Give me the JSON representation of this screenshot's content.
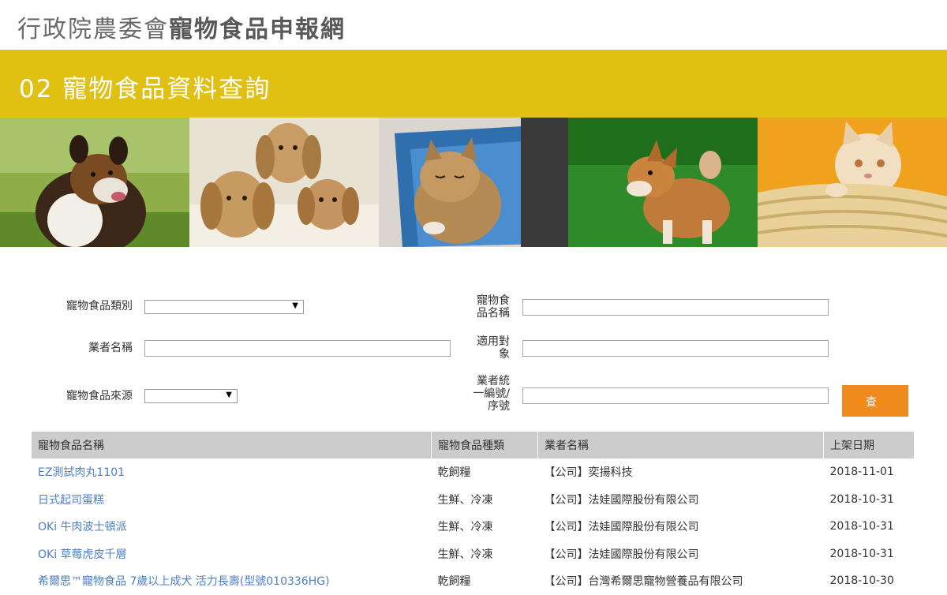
{
  "header": {
    "title_light": "行政院農委會",
    "title_bold": "寵物食品申報網"
  },
  "section": {
    "title": "02 寵物食品資料查詢"
  },
  "photos": [
    {
      "subject": "collie-dog"
    },
    {
      "subject": "dachshund-puppies"
    },
    {
      "subject": "tabby-kitten"
    },
    {
      "subject": "shiba-puppy"
    },
    {
      "subject": "cat-in-basket"
    }
  ],
  "form": {
    "category_label": "寵物食品類別",
    "category_value": "",
    "product_name_label": "寵物食品名稱",
    "product_name_value": "",
    "vendor_label": "業者名稱",
    "vendor_value": "",
    "target_label": "適用對象",
    "target_value": "",
    "source_label": "寵物食品來源",
    "source_value": "",
    "tax_id_label": "業者統一編號/序號",
    "tax_id_value": "",
    "query_label": "查詢"
  },
  "table": {
    "headers": [
      "寵物食品名稱",
      "寵物食品種類",
      "業者名稱",
      "上架日期"
    ],
    "rows": [
      [
        "EZ測試肉丸1101",
        "乾飼糧",
        "【公司】奕揚科技",
        "2018-11-01"
      ],
      [
        "日式起司蛋糕",
        "生鮮、冷凍",
        "【公司】法娃國際股份有限公司",
        "2018-10-31"
      ],
      [
        "OKi 牛肉波士頓派",
        "生鮮、冷凍",
        "【公司】法娃國際股份有限公司",
        "2018-10-31"
      ],
      [
        "OKi 草莓虎皮千層",
        "生鮮、冷凍",
        "【公司】法娃國際股份有限公司",
        "2018-10-31"
      ],
      [
        "希爾思™寵物食品 7歲以上成犬 活力長壽(型號010336HG)",
        "乾飼糧",
        "【公司】台灣希爾思寵物營養品有限公司",
        "2018-10-30"
      ]
    ]
  }
}
